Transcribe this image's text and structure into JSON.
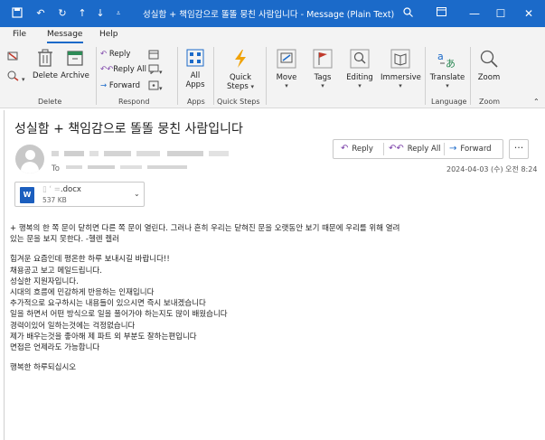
{
  "window": {
    "title": "성실함 + 책임감으로 똘똘 뭉친 사람입니다  -  Message (Plain Text)",
    "controls": {
      "minimize": "—",
      "maximize": "☐",
      "close": "✕"
    }
  },
  "menu": {
    "items": [
      "File",
      "Message",
      "Help"
    ],
    "active": "Message"
  },
  "ribbon": {
    "delete_group": {
      "delete": "Delete",
      "archive": "Archive",
      "label": "Delete"
    },
    "respond_group": {
      "reply": "Reply",
      "reply_all": "Reply All",
      "forward": "Forward",
      "label": "Respond"
    },
    "apps_group": {
      "all_apps": "All Apps",
      "label": "Apps"
    },
    "quick_steps_group": {
      "quick_steps": "Quick Steps",
      "label": "Quick Steps"
    },
    "move": "Move",
    "tags": "Tags",
    "editing": "Editing",
    "immersive": "Immersive",
    "language_group": {
      "translate": "Translate",
      "label": "Language"
    },
    "zoom_group": {
      "zoom": "Zoom",
      "label": "Zoom"
    }
  },
  "message": {
    "subject": "성실함 + 책임감으로 똘똘 뭉친 사람입니다",
    "to_label": "To",
    "actions": {
      "reply": "Reply",
      "reply_all": "Reply All",
      "forward": "Forward",
      "more": "···"
    },
    "date": "2024-04-03 (수) 오전 8:24",
    "attachment": {
      "name": ".docx",
      "size": "537 KB",
      "type": "W"
    },
    "body": [
      "+ 행복의 한 쪽 문이 닫히면 다른 쪽 문이 열린다. 그러나 흔히 우리는 닫혀진 문을 오랫동안 보기 때문에 우리를 위해 열려",
      "있는 문을 보지 못한다. -헬렌 켈러",
      "",
      "힘겨운 요즘인데 평온한 하루 보내시길 바랍니다!!",
      "채용공고 보고 메일드립니다.",
      "성실한 지원자입니다.",
      "시대의 흐름에 민감하게 반응하는 인재입니다",
      "추가적으로 요구하시는 내용들이 있으시면 즉시 보내겠습니다",
      "일을 하면서 어떤 방식으로 일을 풀어가야 하는지도 많이 배웠습니다",
      "경력이있어 일하는것에는 걱정없습니다",
      "제가  배우는것을 좋아해 제 파트 외 부분도 잘하는편입니다",
      "면접은 언제라도 가능합니다",
      "",
      "행복한 하루되십시오"
    ]
  }
}
